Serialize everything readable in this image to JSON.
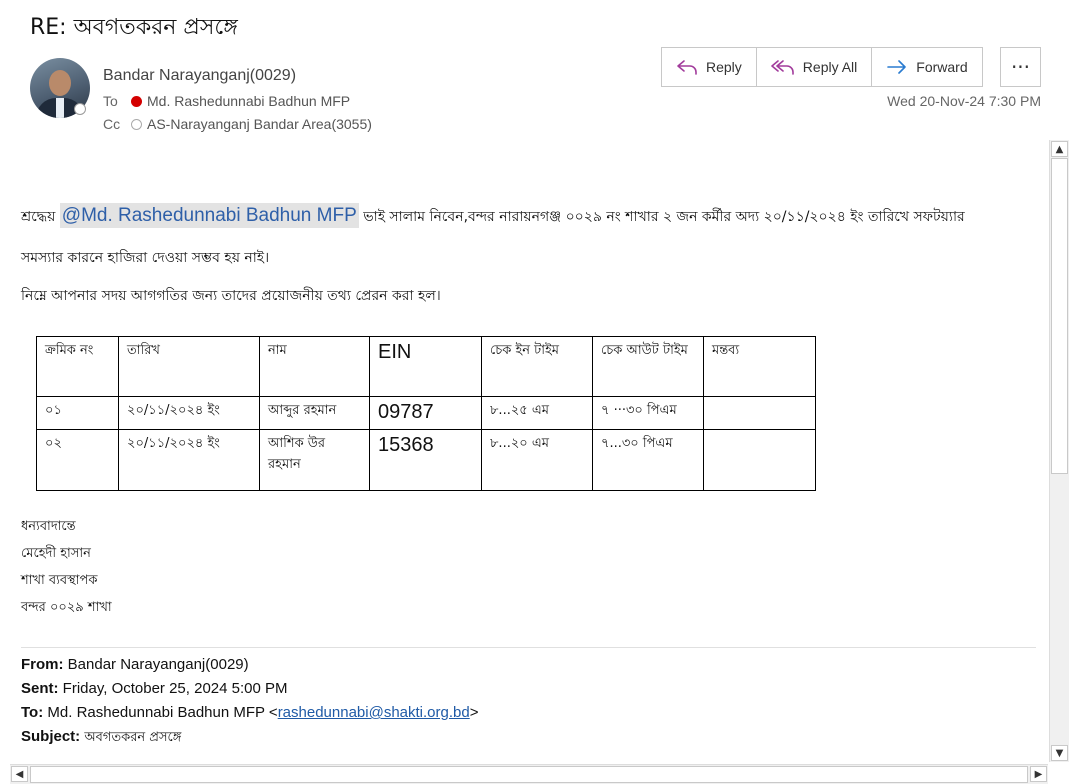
{
  "email": {
    "subject": "RE: অবগতকরন প্রসঙ্গে",
    "sender": "Bandar Narayanganj(0029)",
    "to_label": "To",
    "to_value": "Md. Rashedunnabi Badhun MFP",
    "cc_label": "Cc",
    "cc_value": "AS-Narayanganj Bandar Area(3055)",
    "date": "Wed 20-Nov-24 7:30 PM"
  },
  "actions": {
    "reply": "Reply",
    "reply_all": "Reply All",
    "forward": "Forward",
    "more": "···"
  },
  "colors": {
    "presence_to": "#d40000",
    "mention_text": "#2e5fa8",
    "link": "#1f5aa6",
    "reply_all_icon": "#a23c9c",
    "forward_icon": "#2a7bd0"
  },
  "body": {
    "greeting": "শ্রদ্ধেয়",
    "mention": "@Md. Rashedunnabi Badhun MFP",
    "line1_rest": "ভাই সালাম নিবেন,বন্দর নারায়নগঞ্জ ০০২৯ নং শাখার ২ জন কর্মীর অদ্য ২০/১১/২০২৪ ইং তারিখে সফটয়্যার",
    "line2": "সমস্যার কারনে হাজিরা দেওয়া সম্ভব হয় নাই।",
    "line3": "নিম্নে আপনার সদয় আগগতির জন্য তাদের প্রয়োজনীয় তথ্য প্রেরন করা হল।"
  },
  "table": {
    "headers": [
      "ক্রমিক নং",
      "তারিখ",
      "নাম",
      "EIN",
      "চেক ইন টাইম",
      "চেক আউট টাইম",
      "মন্তব্য"
    ],
    "rows": [
      [
        "০১",
        "২০/১১/২০২৪ ইং",
        "আব্দুর রহমান",
        "09787",
        "৮...২৫ এম",
        "৭ ···৩০ পিএম",
        ""
      ],
      [
        "০২",
        "২০/১১/২০২৪ ইং",
        "আশিক উর রহমান",
        "15368",
        "৮...২০ এম",
        "৭...৩০ পিএম",
        ""
      ]
    ]
  },
  "signature": [
    "ধন্যবাদান্তে",
    "মেহেদী হাসান",
    "শাখা ব্যবস্থাপক",
    "বন্দর ০০২৯ শাখা"
  ],
  "forwarded": {
    "from_label": "From:",
    "from_value": "Bandar Narayanganj(0029)",
    "sent_label": "Sent:",
    "sent_value": "Friday, October 25, 2024 5:00 PM",
    "to_label": "To:",
    "to_name": "Md. Rashedunnabi Badhun MFP <",
    "to_email": "rashedunnabi@shakti.org.bd",
    "to_close": ">",
    "subject_label": "Subject:",
    "subject_value": "অবগতকরন প্রসঙ্গে"
  }
}
